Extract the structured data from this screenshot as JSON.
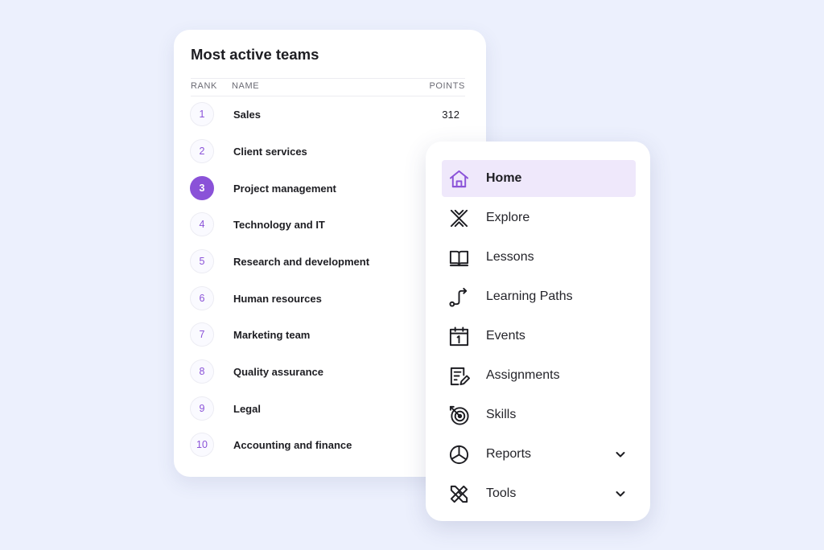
{
  "colors": {
    "background": "#ecf0fd",
    "accent": "#8a52d8",
    "active_nav_bg": "#efe8fb"
  },
  "teams": {
    "title": "Most active teams",
    "columns": {
      "rank": "RANK",
      "name": "NAME",
      "points": "POINTS"
    },
    "active_rank": 3,
    "rows": [
      {
        "rank": "1",
        "name": "Sales",
        "points": "312"
      },
      {
        "rank": "2",
        "name": "Client services",
        "points": ""
      },
      {
        "rank": "3",
        "name": "Project management",
        "points": ""
      },
      {
        "rank": "4",
        "name": "Technology and IT",
        "points": ""
      },
      {
        "rank": "5",
        "name": "Research and development",
        "points": ""
      },
      {
        "rank": "6",
        "name": "Human resources",
        "points": ""
      },
      {
        "rank": "7",
        "name": "Marketing team",
        "points": ""
      },
      {
        "rank": "8",
        "name": "Quality assurance",
        "points": ""
      },
      {
        "rank": "9",
        "name": "Legal",
        "points": ""
      },
      {
        "rank": "10",
        "name": "Accounting and finance",
        "points": ""
      }
    ]
  },
  "nav": {
    "active": "home",
    "items": [
      {
        "label": "Home",
        "icon": "home-icon"
      },
      {
        "label": "Explore",
        "icon": "explore-icon"
      },
      {
        "label": "Lessons",
        "icon": "book-icon"
      },
      {
        "label": "Learning Paths",
        "icon": "path-icon"
      },
      {
        "label": "Events",
        "icon": "calendar-icon"
      },
      {
        "label": "Assignments",
        "icon": "assignment-icon"
      },
      {
        "label": "Skills",
        "icon": "target-icon"
      },
      {
        "label": "Reports",
        "icon": "pie-chart-icon",
        "expandable": true
      },
      {
        "label": "Tools",
        "icon": "tools-icon",
        "expandable": true
      }
    ]
  }
}
